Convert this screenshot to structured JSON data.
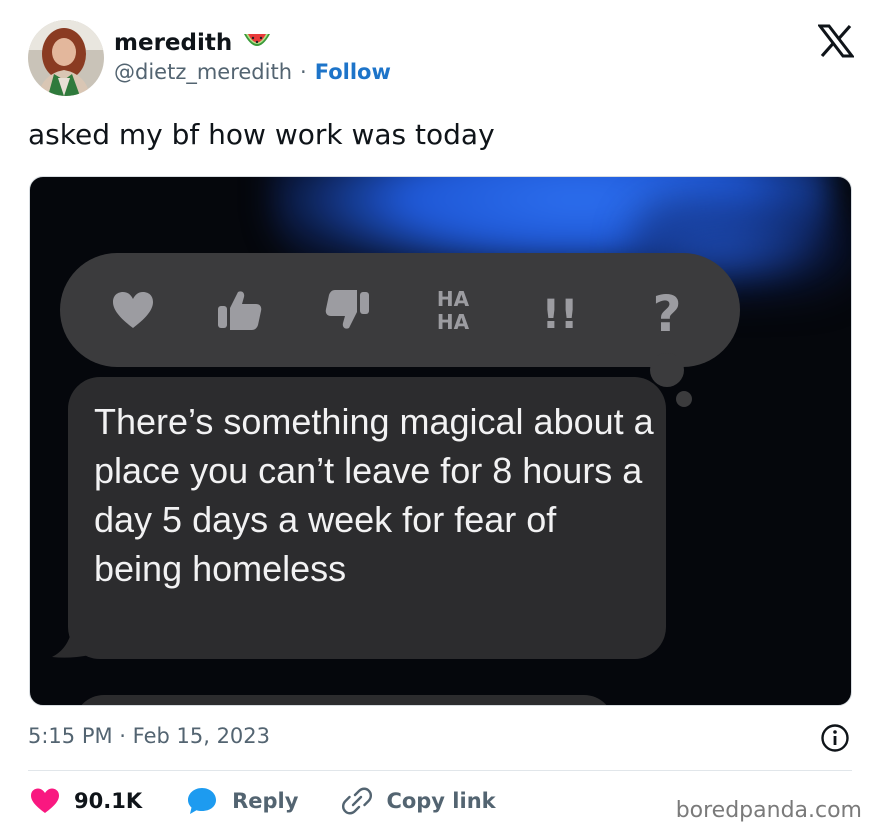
{
  "author": {
    "display_name": "meredith",
    "name_emoji": "watermelon-icon",
    "handle": "@dietz_meredith",
    "separator": "·",
    "follow_label": "Follow"
  },
  "tweet": {
    "text": "asked my bf how work was today",
    "timestamp": "5:15 PM · Feb 15, 2023"
  },
  "media": {
    "tapback_reactions": [
      "heart-icon",
      "thumbs-up-icon",
      "thumbs-down-icon",
      "haha-icon",
      "exclamation-icon",
      "question-icon"
    ],
    "tapback_haha_text": [
      "HA",
      "HA"
    ],
    "tapback_exclaim_text": "!!",
    "tapback_question_text": "?",
    "message_text": "There’s something magical about a place you can’t leave for 8 hours a day 5 days a week for fear of being homeless"
  },
  "actions": {
    "likes_count": "90.1K",
    "reply_label": "Reply",
    "copy_link_label": "Copy link"
  },
  "watermark": "boredpanda.com",
  "colors": {
    "follow_blue": "#1d74c9",
    "like_pink": "#f91880",
    "reply_blue": "#1d9bf0",
    "secondary_text": "#536471",
    "bubble_gray": "#2c2c2e",
    "tapback_gray": "#3b3b3d"
  }
}
